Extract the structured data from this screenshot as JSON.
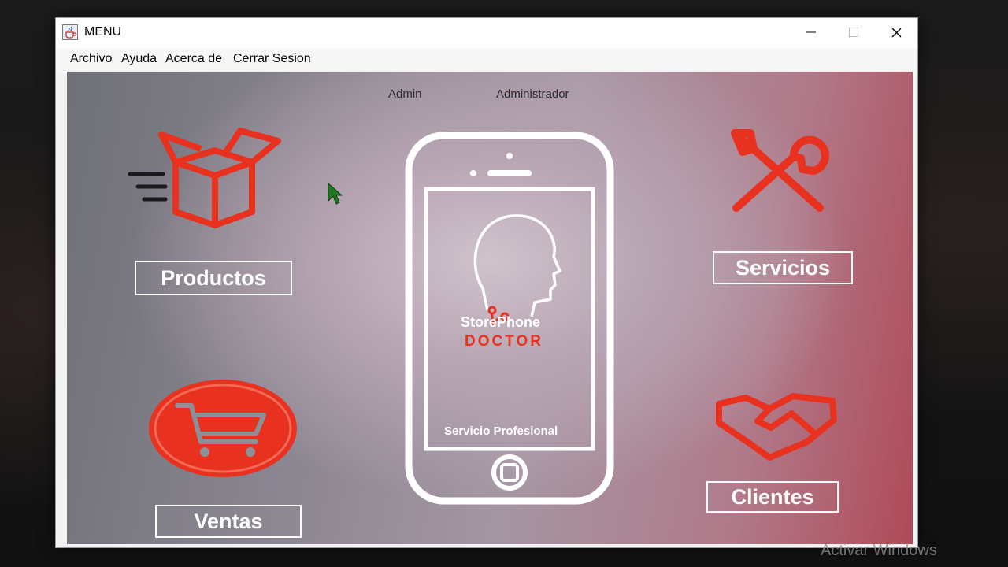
{
  "window": {
    "title": "MENU",
    "icon": "java-cup-icon",
    "controls": [
      "minimize-icon",
      "maximize-icon",
      "close-icon"
    ]
  },
  "menubar": {
    "items": [
      "Archivo",
      "Ayuda",
      "Acerca de",
      "Cerrar Sesion"
    ]
  },
  "user": {
    "username": "Admin",
    "role": "Administrador"
  },
  "buttons": {
    "productos": "Productos",
    "servicios": "Servicios",
    "ventas": "Ventas",
    "clientes": "Clientes"
  },
  "logo": {
    "brand_line1": "StorePhone",
    "brand_line2": "DOCTOR",
    "tagline": "Servicio Profesional"
  },
  "watermark": "Activar Windows",
  "colors": {
    "accent_red": "#e8321f",
    "button_border": "#ffffff"
  }
}
